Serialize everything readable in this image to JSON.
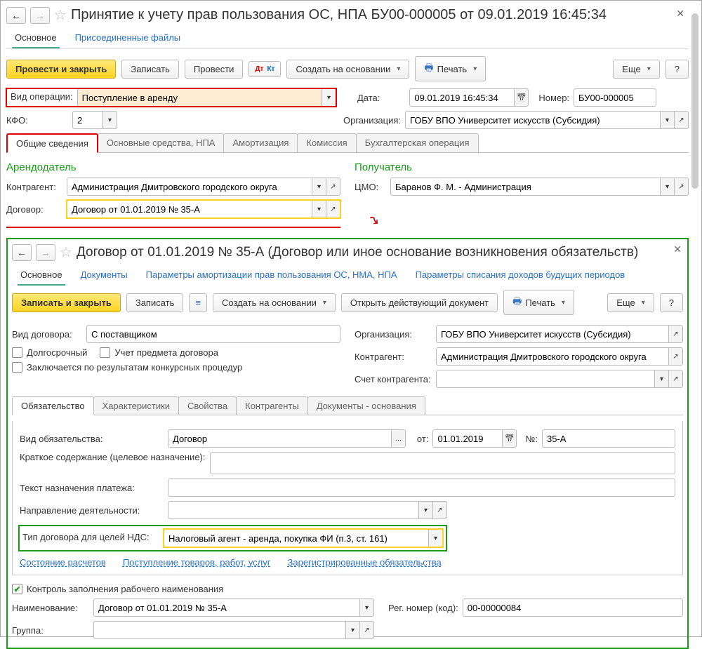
{
  "main": {
    "title": "Принятие к учету прав пользования ОС, НПА БУ00-000005 от 09.01.2019 16:45:34",
    "tabs": {
      "main": "Основное",
      "files": "Присоединенные файлы"
    },
    "toolbar": {
      "post_close": "Провести и закрыть",
      "write": "Записать",
      "post": "Провести",
      "dtkt": "Д͟т Кт",
      "create_based": "Создать на основании",
      "print": "Печать",
      "more": "Еще",
      "help": "?"
    },
    "fields": {
      "op_type_label": "Вид операции:",
      "op_type_value": "Поступление в аренду",
      "date_label": "Дата:",
      "date_value": "09.01.2019 16:45:34",
      "number_label": "Номер:",
      "number_value": "БУ00-000005",
      "kfo_label": "КФО:",
      "kfo_value": "2",
      "org_label": "Организация:",
      "org_value": "ГОБУ ВПО Университет искусств (Субсидия)"
    },
    "inner_tabs": [
      "Общие сведения",
      "Основные средства, НПА",
      "Амортизация",
      "Комиссия",
      "Бухгалтерская операция"
    ],
    "lessor": {
      "title": "Арендодатель",
      "counterparty_label": "Контрагент:",
      "counterparty_value": "Администрация Дмитровского городского округа",
      "contract_label": "Договор:",
      "contract_value": "Договор от 01.01.2019 № 35-А"
    },
    "recipient": {
      "title": "Получатель",
      "cmo_label": "ЦМО:",
      "cmo_value": "Баранов Ф. М. - Администрация"
    }
  },
  "contract": {
    "title": "Договор от 01.01.2019 № 35-А (Договор или иное основание возникновения обязательств)",
    "nav_tabs": {
      "main": "Основное",
      "docs": "Документы",
      "amort": "Параметры амортизации прав пользования ОС, НМА, НПА",
      "writeoff": "Параметры списания доходов будущих периодов"
    },
    "toolbar": {
      "write_close": "Записать и закрыть",
      "write": "Записать",
      "create_based": "Создать на основании",
      "open_doc": "Открыть действующий документ",
      "print": "Печать",
      "more": "Еще",
      "help": "?"
    },
    "fields": {
      "type_label": "Вид договора:",
      "type_value": "С поставщиком",
      "longterm": "Долгосрочный",
      "subject": "Учет предмета договора",
      "competitive": "Заключается по результатам конкурсных процедур",
      "org_label": "Организация:",
      "org_value": "ГОБУ ВПО Университет искусств (Субсидия)",
      "counterparty_label": "Контрагент:",
      "counterparty_value": "Администрация Дмитровского городского округа",
      "account_label": "Счет контрагента:"
    },
    "obl_tabs": [
      "Обязательство",
      "Характеристики",
      "Свойства",
      "Контрагенты",
      "Документы - основания"
    ],
    "obligation": {
      "kind_label": "Вид обязательства:",
      "kind_value": "Договор",
      "from_label": "от:",
      "from_value": "01.01.2019",
      "num_label": "№:",
      "num_value": "35-А",
      "summary_label": "Краткое содержание (целевое назначение):",
      "payment_label": "Текст назначения платежа:",
      "activity_label": "Направление деятельности:",
      "vat_label": "Тип договора для целей НДС:",
      "vat_value": "Налоговый агент - аренда, покупка ФИ (п.3, ст. 161)"
    },
    "links": {
      "settlements": "Состояние расчетов",
      "goods": "Поступление товаров, работ, услуг",
      "registered": "Зарегистрированные обязательства"
    },
    "bottom": {
      "control": "Контроль заполнения рабочего наименования",
      "name_label": "Наименование:",
      "name_value": "Договор от 01.01.2019 № 35-А",
      "reg_label": "Рег. номер (код):",
      "reg_value": "00-00000084",
      "group_label": "Группа:"
    }
  }
}
